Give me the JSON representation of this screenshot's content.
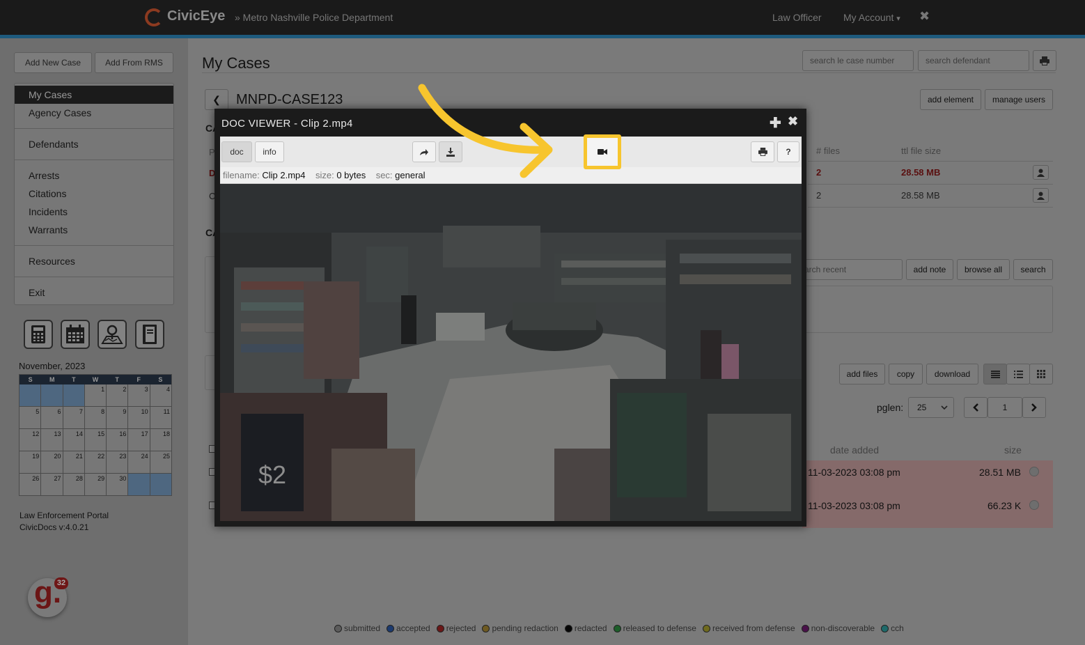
{
  "header": {
    "brand": "CivicEye",
    "department": "» Metro Nashville Police Department",
    "role": "Law Officer",
    "account": "My Account",
    "account_caret": "▾",
    "close_glyph": "✖"
  },
  "sidebar": {
    "add_new_case": "Add New Case",
    "add_from_rms": "Add From RMS",
    "nav": [
      {
        "label": "My Cases",
        "active": true
      },
      {
        "label": "Agency Cases"
      },
      {
        "label": "Defendants"
      },
      {
        "label": "Arrests"
      },
      {
        "label": "Citations"
      },
      {
        "label": "Incidents"
      },
      {
        "label": "Warrants"
      },
      {
        "label": "Resources"
      },
      {
        "label": "Exit"
      }
    ],
    "tools": [
      "calculator-icon",
      "calendar-icon",
      "map-icon",
      "notebook-icon"
    ],
    "calendar": {
      "month": "November, 2023",
      "weekdays": [
        "S",
        "M",
        "T",
        "W",
        "T",
        "F",
        "S"
      ],
      "weeks": [
        [
          "",
          "",
          "",
          "1",
          "2",
          "3",
          "4"
        ],
        [
          "5",
          "6",
          "7",
          "8",
          "9",
          "10",
          "11"
        ],
        [
          "12",
          "13",
          "14",
          "15",
          "16",
          "17",
          "18"
        ],
        [
          "19",
          "20",
          "21",
          "22",
          "23",
          "24",
          "25"
        ],
        [
          "26",
          "27",
          "28",
          "29",
          "30",
          "",
          ""
        ]
      ]
    },
    "footer_line1": "Law Enforcement Portal",
    "footer_line2": "CivicDocs v:4.0.21",
    "badge_letter": "g.",
    "badge_count": "32"
  },
  "main": {
    "title": "My Cases",
    "search_case_placeholder": "search le case number",
    "search_defendant_placeholder": "search defendant",
    "case_back_glyph": "❮",
    "case_name": "MNPD-CASE123",
    "add_element": "add element",
    "manage_users": "manage users",
    "ca_label": "CA",
    "p_label": "P",
    "d_label": "D",
    "c_label": "C",
    "ca2_label": "CA",
    "files_header": "# files",
    "size_header": "ttl file size",
    "rows": [
      {
        "files": "2",
        "size": "28.58 MB"
      },
      {
        "files": "2",
        "size": "28.58 MB"
      }
    ],
    "search_recent_placeholder": "arch recent",
    "add_note": "add note",
    "browse_all": "browse all",
    "search": "search",
    "add_files": "add files",
    "copy": "copy",
    "download": "download",
    "pglen_label": "pglen:",
    "pglen_value": "25",
    "page_value": "1",
    "date_header": "date added",
    "filesize_header": "size",
    "file_rows": [
      {
        "date": "11-03-2023 03:08 pm",
        "size": "28.51 MB"
      },
      {
        "date": "11-03-2023 03:08 pm",
        "size": "66.23 K"
      }
    ]
  },
  "legend": [
    {
      "label": "submitted",
      "color": "#5c5c5c"
    },
    {
      "label": "accepted",
      "color": "#1c3a6e"
    },
    {
      "label": "rejected",
      "color": "#6a1717"
    },
    {
      "label": "pending redaction",
      "color": "#6e5a22"
    },
    {
      "label": "redacted",
      "color": "#050505"
    },
    {
      "label": "released to defense",
      "color": "#1d5e2a"
    },
    {
      "label": "received from defense",
      "color": "#6f6a1e"
    },
    {
      "label": "non-discoverable",
      "color": "#4a124a"
    },
    {
      "label": "cch",
      "color": "#1e6a6a"
    }
  ],
  "doc_viewer": {
    "title": "DOC VIEWER - Clip 2.mp4",
    "tab_doc": "doc",
    "tab_info": "info",
    "help": "?",
    "info_filename_label": "filename:",
    "info_filename": "Clip 2.mp4",
    "info_size_label": "size:",
    "info_size": "0 bytes",
    "info_sec_label": "sec:",
    "info_sec": "general"
  },
  "colors": {
    "callout": "#f7c52e",
    "topbar": "#1a1a1a",
    "stripe": "#1e5a7d"
  }
}
